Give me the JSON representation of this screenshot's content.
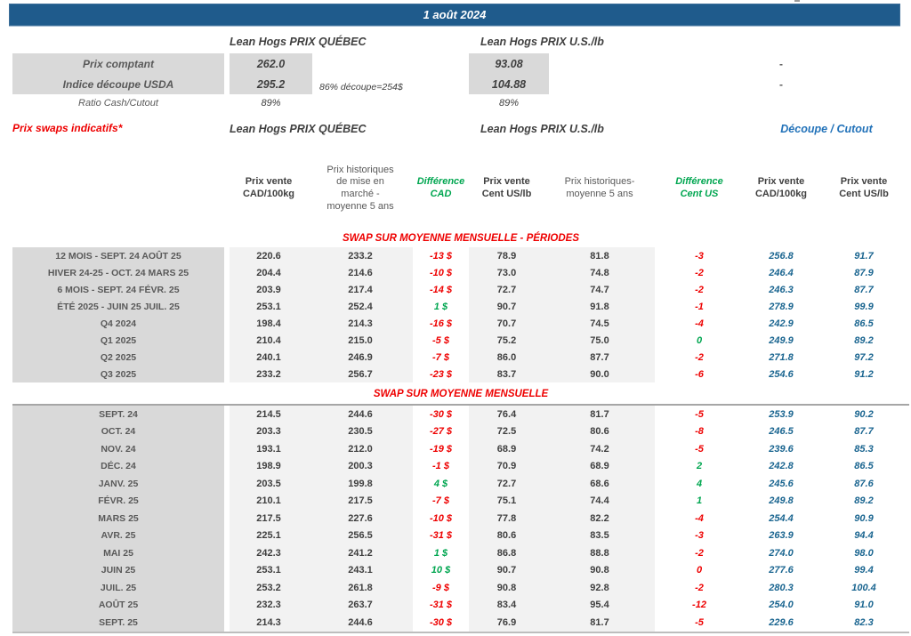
{
  "page": {
    "date": "1 août 2024"
  },
  "colors": {
    "bar_blue": "#1F5B8C",
    "red": "#EE0000",
    "green": "#00A650",
    "cutout_blue": "#1A6590",
    "header_blue": "#2272B9",
    "label_bg": "#d9d9d9",
    "band_bg": "#f2f2f2"
  },
  "top_section": {
    "qc_header": "Lean Hogs PRIX QUÉBEC",
    "us_header": "Lean Hogs PRIX U.S./lb",
    "rows": [
      {
        "label": "Prix comptant",
        "qc": "262.0",
        "note": "",
        "us": "93.08",
        "right": "-"
      },
      {
        "label": "Indice découpe USDA",
        "qc": "295.2",
        "note": "86% découpe=254$",
        "us": "104.88",
        "right": "-"
      },
      {
        "label": "Ratio Cash/Cutout",
        "qc": "89%",
        "note": "",
        "us": "89%",
        "right": ""
      }
    ]
  },
  "swaps": {
    "title": "Prix swaps indicatifs*",
    "qc_header": "Lean Hogs PRIX QUÉBEC",
    "us_header": "Lean Hogs PRIX U.S./lb",
    "cutout_header": "Découpe / Cutout",
    "columns": [
      {
        "label": "Prix vente\nCAD/100kg",
        "style": "bold"
      },
      {
        "label": "Prix historiques\nde mise en\nmarché -\nmoyenne 5 ans",
        "style": "plain"
      },
      {
        "label": "Différence\nCAD",
        "style": "green"
      },
      {
        "label": "Prix vente\nCent US/lb",
        "style": "bold"
      },
      {
        "label": "Prix historiques-\nmoyenne 5 ans",
        "style": "plain"
      },
      {
        "label": "Différence\nCent US",
        "style": "green"
      },
      {
        "label": "Prix vente\nCAD/100kg",
        "style": "bold"
      },
      {
        "label": "Prix vente\nCent US/lb",
        "style": "bold"
      }
    ],
    "sections": [
      {
        "title": "SWAP SUR MOYENNE MENSUELLE - PÉRIODES",
        "rows": [
          {
            "label": "12 MOIS - SEPT. 24 AOÛT 25",
            "cad": "220.6",
            "cad_hist": "233.2",
            "diff_cad": "-13 $",
            "diff_cad_color": "red",
            "us": "78.9",
            "us_hist": "81.8",
            "diff_us": "-3",
            "diff_us_color": "red",
            "cut_cad": "256.8",
            "cut_us": "91.7"
          },
          {
            "label": "HIVER 24-25 - OCT. 24 MARS 25",
            "cad": "204.4",
            "cad_hist": "214.6",
            "diff_cad": "-10 $",
            "diff_cad_color": "red",
            "us": "73.0",
            "us_hist": "74.8",
            "diff_us": "-2",
            "diff_us_color": "red",
            "cut_cad": "246.4",
            "cut_us": "87.9"
          },
          {
            "label": "6 MOIS - SEPT. 24 FÉVR. 25",
            "cad": "203.9",
            "cad_hist": "217.4",
            "diff_cad": "-14 $",
            "diff_cad_color": "red",
            "us": "72.7",
            "us_hist": "74.7",
            "diff_us": "-2",
            "diff_us_color": "red",
            "cut_cad": "246.3",
            "cut_us": "87.7"
          },
          {
            "label": "ÉTÉ 2025 - JUIN 25 JUIL. 25",
            "cad": "253.1",
            "cad_hist": "252.4",
            "diff_cad": "1 $",
            "diff_cad_color": "green",
            "us": "90.7",
            "us_hist": "91.8",
            "diff_us": "-1",
            "diff_us_color": "red",
            "cut_cad": "278.9",
            "cut_us": "99.9"
          },
          {
            "label": "Q4 2024",
            "cad": "198.4",
            "cad_hist": "214.3",
            "diff_cad": "-16 $",
            "diff_cad_color": "red",
            "us": "70.7",
            "us_hist": "74.5",
            "diff_us": "-4",
            "diff_us_color": "red",
            "cut_cad": "242.9",
            "cut_us": "86.5"
          },
          {
            "label": "Q1 2025",
            "cad": "210.4",
            "cad_hist": "215.0",
            "diff_cad": "-5 $",
            "diff_cad_color": "red",
            "us": "75.2",
            "us_hist": "75.0",
            "diff_us": "0",
            "diff_us_color": "green",
            "cut_cad": "249.9",
            "cut_us": "89.2"
          },
          {
            "label": "Q2 2025",
            "cad": "240.1",
            "cad_hist": "246.9",
            "diff_cad": "-7 $",
            "diff_cad_color": "red",
            "us": "86.0",
            "us_hist": "87.7",
            "diff_us": "-2",
            "diff_us_color": "red",
            "cut_cad": "271.8",
            "cut_us": "97.2"
          },
          {
            "label": "Q3 2025",
            "cad": "233.2",
            "cad_hist": "256.7",
            "diff_cad": "-23 $",
            "diff_cad_color": "red",
            "us": "83.7",
            "us_hist": "90.0",
            "diff_us": "-6",
            "diff_us_color": "red",
            "cut_cad": "254.6",
            "cut_us": "91.2"
          }
        ]
      },
      {
        "title": "SWAP SUR MOYENNE MENSUELLE",
        "rows": [
          {
            "label": "SEPT. 24",
            "cad": "214.5",
            "cad_hist": "244.6",
            "diff_cad": "-30 $",
            "diff_cad_color": "red",
            "us": "76.4",
            "us_hist": "81.7",
            "diff_us": "-5",
            "diff_us_color": "red",
            "cut_cad": "253.9",
            "cut_us": "90.2"
          },
          {
            "label": "OCT. 24",
            "cad": "203.3",
            "cad_hist": "230.5",
            "diff_cad": "-27 $",
            "diff_cad_color": "red",
            "us": "72.5",
            "us_hist": "80.6",
            "diff_us": "-8",
            "diff_us_color": "red",
            "cut_cad": "246.5",
            "cut_us": "87.7"
          },
          {
            "label": "NOV. 24",
            "cad": "193.1",
            "cad_hist": "212.0",
            "diff_cad": "-19 $",
            "diff_cad_color": "red",
            "us": "68.9",
            "us_hist": "74.2",
            "diff_us": "-5",
            "diff_us_color": "red",
            "cut_cad": "239.6",
            "cut_us": "85.3"
          },
          {
            "label": "DÉC. 24",
            "cad": "198.9",
            "cad_hist": "200.3",
            "diff_cad": "-1 $",
            "diff_cad_color": "red",
            "us": "70.9",
            "us_hist": "68.9",
            "diff_us": "2",
            "diff_us_color": "green",
            "cut_cad": "242.8",
            "cut_us": "86.5"
          },
          {
            "label": "JANV. 25",
            "cad": "203.5",
            "cad_hist": "199.8",
            "diff_cad": "4 $",
            "diff_cad_color": "green",
            "us": "72.7",
            "us_hist": "68.6",
            "diff_us": "4",
            "diff_us_color": "green",
            "cut_cad": "245.6",
            "cut_us": "87.6"
          },
          {
            "label": "FÉVR. 25",
            "cad": "210.1",
            "cad_hist": "217.5",
            "diff_cad": "-7 $",
            "diff_cad_color": "red",
            "us": "75.1",
            "us_hist": "74.4",
            "diff_us": "1",
            "diff_us_color": "green",
            "cut_cad": "249.8",
            "cut_us": "89.2"
          },
          {
            "label": "MARS 25",
            "cad": "217.5",
            "cad_hist": "227.6",
            "diff_cad": "-10 $",
            "diff_cad_color": "red",
            "us": "77.8",
            "us_hist": "82.2",
            "diff_us": "-4",
            "diff_us_color": "red",
            "cut_cad": "254.4",
            "cut_us": "90.9"
          },
          {
            "label": "AVR. 25",
            "cad": "225.1",
            "cad_hist": "256.5",
            "diff_cad": "-31 $",
            "diff_cad_color": "red",
            "us": "80.6",
            "us_hist": "83.5",
            "diff_us": "-3",
            "diff_us_color": "red",
            "cut_cad": "263.9",
            "cut_us": "94.4"
          },
          {
            "label": "MAI 25",
            "cad": "242.3",
            "cad_hist": "241.2",
            "diff_cad": "1 $",
            "diff_cad_color": "green",
            "us": "86.8",
            "us_hist": "88.8",
            "diff_us": "-2",
            "diff_us_color": "red",
            "cut_cad": "274.0",
            "cut_us": "98.0"
          },
          {
            "label": "JUIN 25",
            "cad": "253.1",
            "cad_hist": "243.1",
            "diff_cad": "10 $",
            "diff_cad_color": "green",
            "us": "90.7",
            "us_hist": "90.8",
            "diff_us": "0",
            "diff_us_color": "red",
            "cut_cad": "277.6",
            "cut_us": "99.4"
          },
          {
            "label": "JUIL. 25",
            "cad": "253.2",
            "cad_hist": "261.8",
            "diff_cad": "-9 $",
            "diff_cad_color": "red",
            "us": "90.8",
            "us_hist": "92.8",
            "diff_us": "-2",
            "diff_us_color": "red",
            "cut_cad": "280.3",
            "cut_us": "100.4"
          },
          {
            "label": "AOÛT 25",
            "cad": "232.3",
            "cad_hist": "263.7",
            "diff_cad": "-31 $",
            "diff_cad_color": "red",
            "us": "83.4",
            "us_hist": "95.4",
            "diff_us": "-12",
            "diff_us_color": "red",
            "cut_cad": "254.0",
            "cut_us": "91.0"
          },
          {
            "label": "SEPT. 25",
            "cad": "214.3",
            "cad_hist": "244.6",
            "diff_cad": "-30 $",
            "diff_cad_color": "red",
            "us": "76.9",
            "us_hist": "81.7",
            "diff_us": "-5",
            "diff_us_color": "red",
            "cut_cad": "229.6",
            "cut_us": "82.3"
          }
        ]
      }
    ]
  }
}
